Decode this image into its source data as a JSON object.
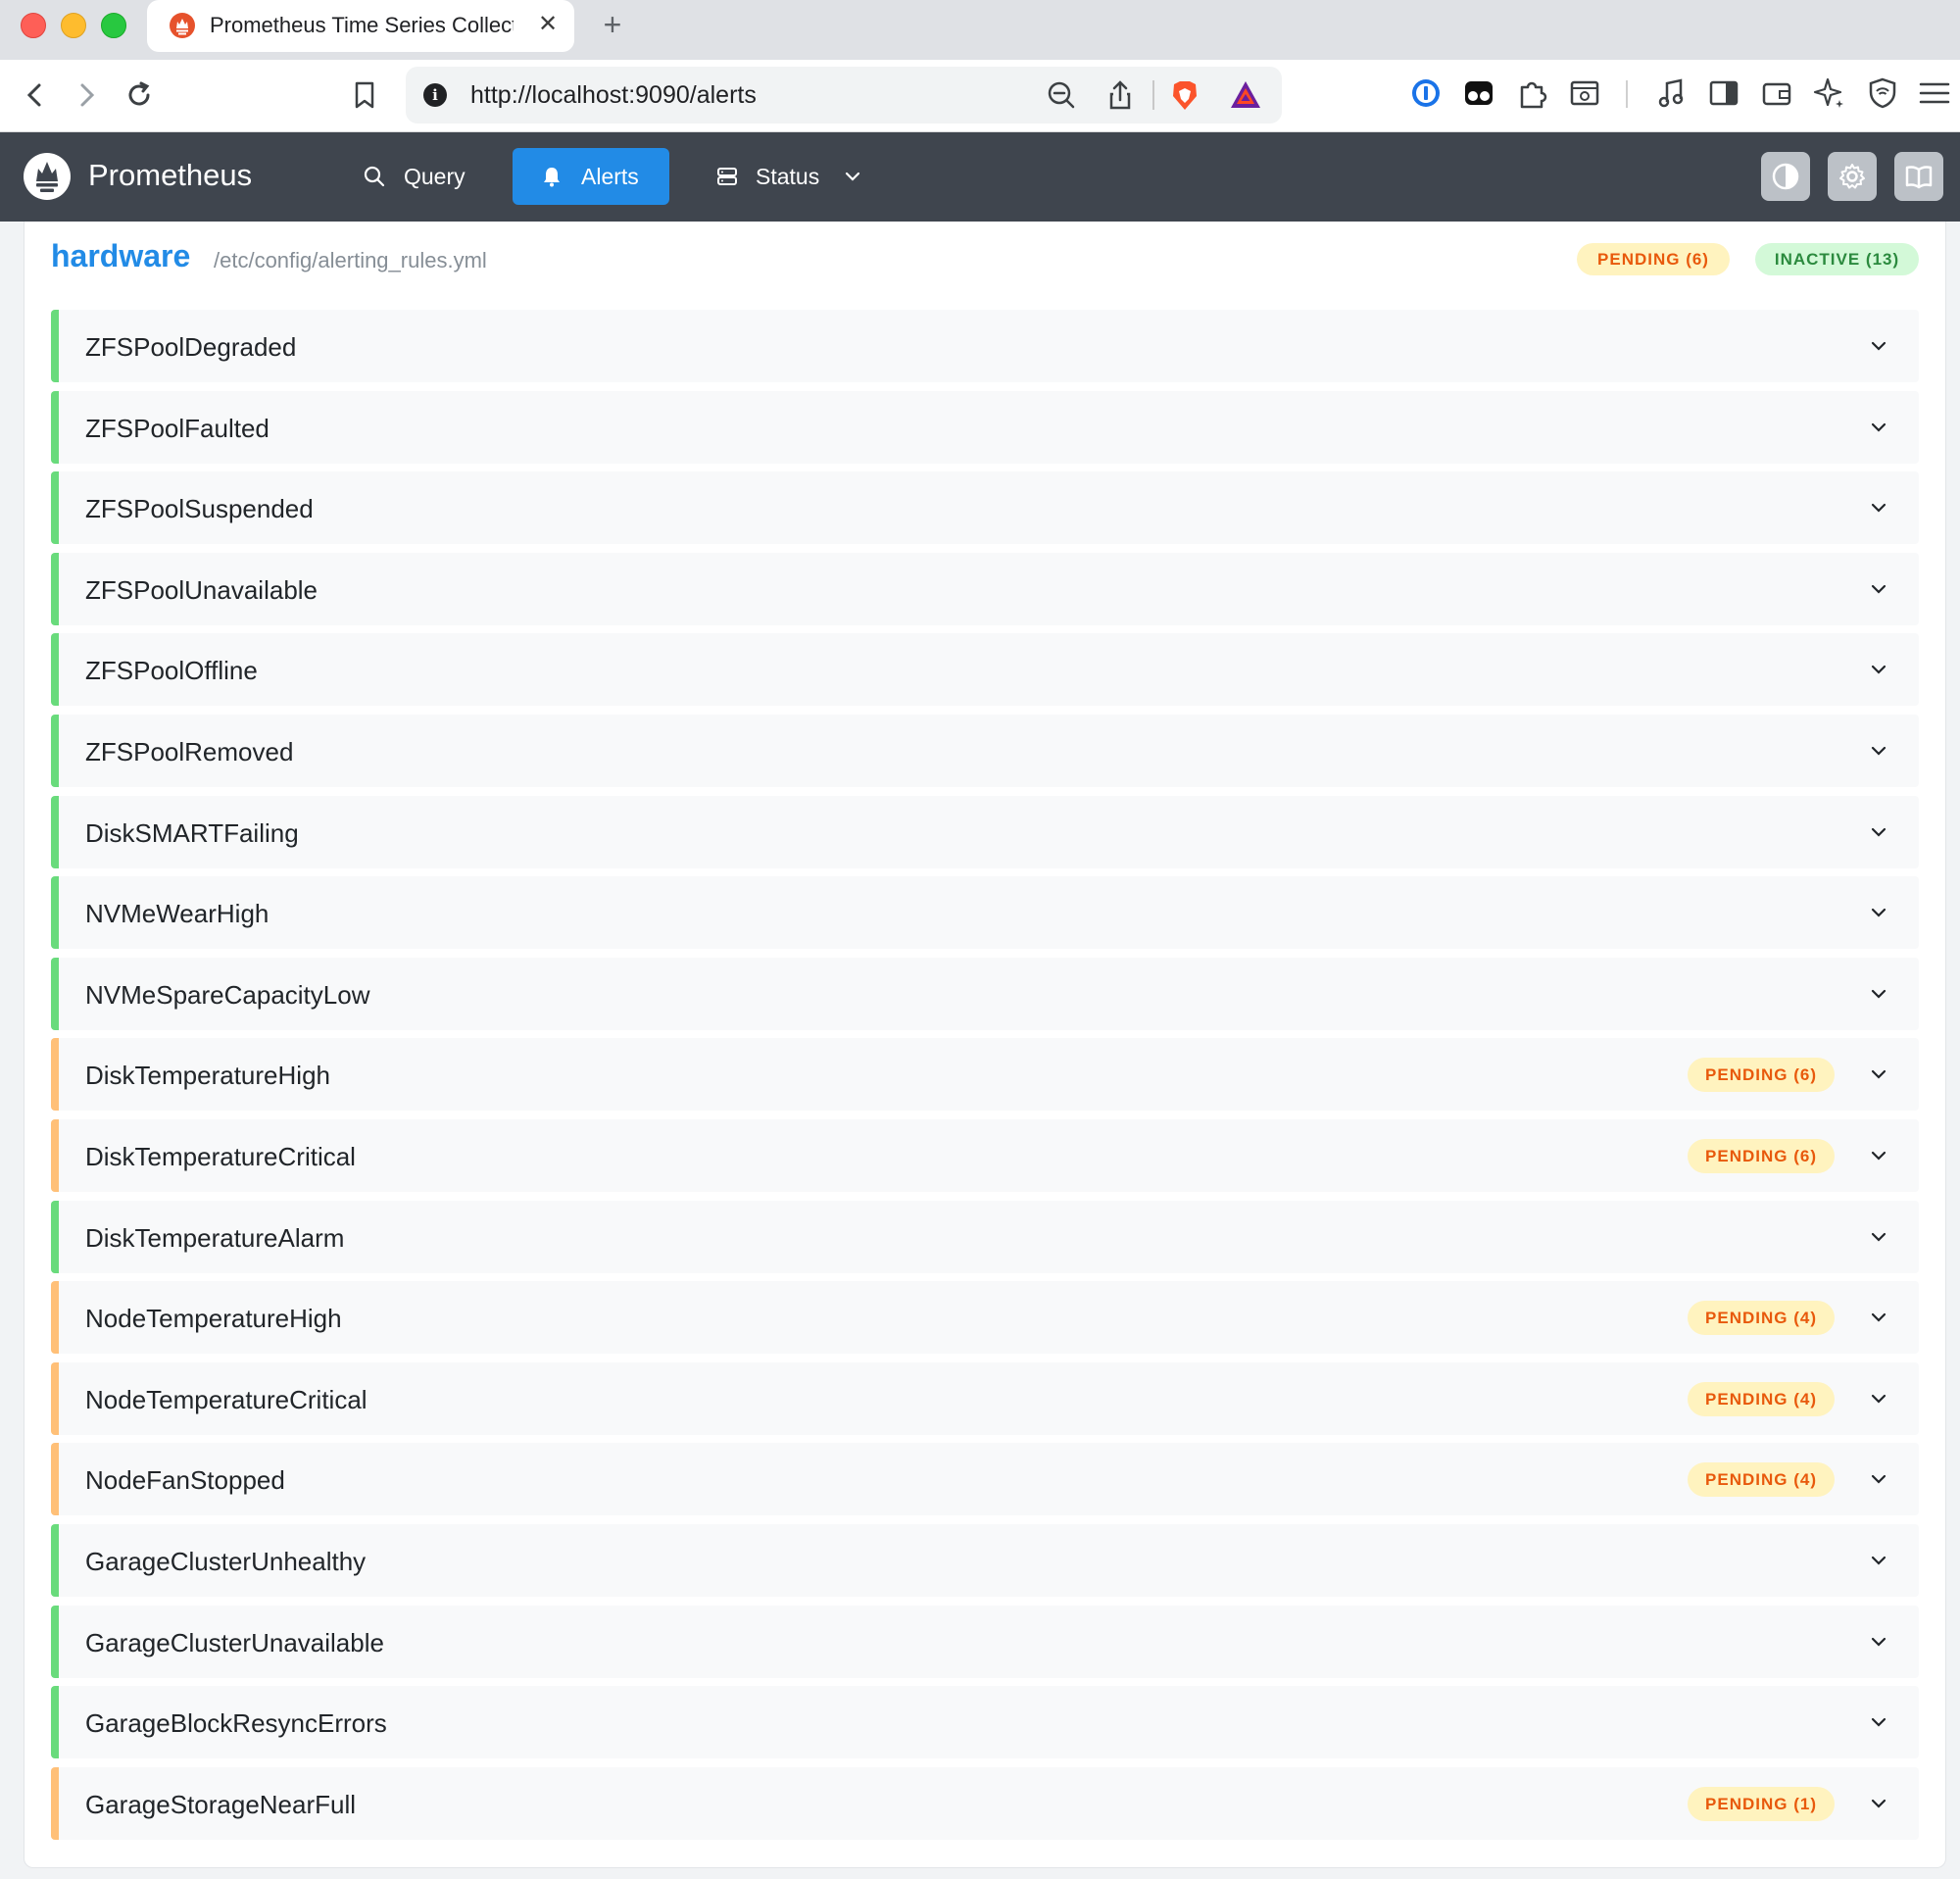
{
  "browser": {
    "tab_title": "Prometheus Time Series Collection",
    "new_tab_label": "+",
    "close_label": "✕",
    "url": "http://localhost:9090/alerts",
    "info_icon_label": "i"
  },
  "navbar": {
    "brand": "Prometheus",
    "links": [
      {
        "label": "Query",
        "icon": "search-icon"
      },
      {
        "label": "Alerts",
        "icon": "bell-icon",
        "active": true
      },
      {
        "label": "Status",
        "icon": "server-icon"
      }
    ]
  },
  "group": {
    "name": "hardware",
    "file": "/etc/config/alerting_rules.yml",
    "summary": {
      "pending": "PENDING (6)",
      "inactive": "INACTIVE (13)"
    }
  },
  "colors": {
    "accent": "#228be6",
    "inactive": "#69db7c",
    "pending": "#ffc078"
  },
  "rules": [
    {
      "name": "ZFSPoolDegraded",
      "state": "inactive",
      "badge": ""
    },
    {
      "name": "ZFSPoolFaulted",
      "state": "inactive",
      "badge": ""
    },
    {
      "name": "ZFSPoolSuspended",
      "state": "inactive",
      "badge": ""
    },
    {
      "name": "ZFSPoolUnavailable",
      "state": "inactive",
      "badge": ""
    },
    {
      "name": "ZFSPoolOffline",
      "state": "inactive",
      "badge": ""
    },
    {
      "name": "ZFSPoolRemoved",
      "state": "inactive",
      "badge": ""
    },
    {
      "name": "DiskSMARTFailing",
      "state": "inactive",
      "badge": ""
    },
    {
      "name": "NVMeWearHigh",
      "state": "inactive",
      "badge": ""
    },
    {
      "name": "NVMeSpareCapacityLow",
      "state": "inactive",
      "badge": ""
    },
    {
      "name": "DiskTemperatureHigh",
      "state": "pending",
      "badge": "PENDING (6)"
    },
    {
      "name": "DiskTemperatureCritical",
      "state": "pending",
      "badge": "PENDING (6)"
    },
    {
      "name": "DiskTemperatureAlarm",
      "state": "inactive",
      "badge": ""
    },
    {
      "name": "NodeTemperatureHigh",
      "state": "pending",
      "badge": "PENDING (4)"
    },
    {
      "name": "NodeTemperatureCritical",
      "state": "pending",
      "badge": "PENDING (4)"
    },
    {
      "name": "NodeFanStopped",
      "state": "pending",
      "badge": "PENDING (4)"
    },
    {
      "name": "GarageClusterUnhealthy",
      "state": "inactive",
      "badge": ""
    },
    {
      "name": "GarageClusterUnavailable",
      "state": "inactive",
      "badge": ""
    },
    {
      "name": "GarageBlockResyncErrors",
      "state": "inactive",
      "badge": ""
    },
    {
      "name": "GarageStorageNearFull",
      "state": "pending",
      "badge": "PENDING (1)"
    }
  ]
}
